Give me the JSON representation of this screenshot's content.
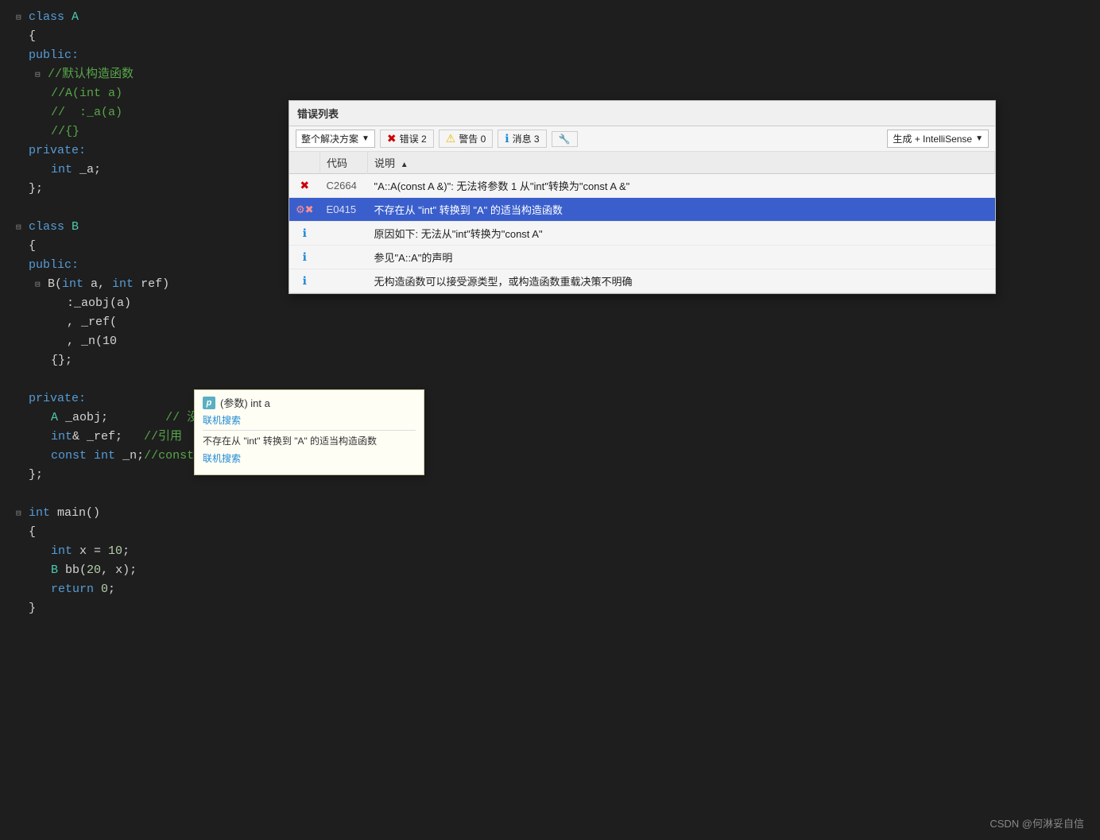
{
  "editor": {
    "lines": [
      {
        "indent": 0,
        "content": "class A",
        "type": "class-decl",
        "collapse": "⊟"
      },
      {
        "indent": 0,
        "content": "{",
        "type": "brace"
      },
      {
        "indent": 0,
        "content": "public:",
        "type": "access"
      },
      {
        "indent": 1,
        "content": "//默认构造函数",
        "type": "comment",
        "collapse": "⊟"
      },
      {
        "indent": 1,
        "content": "//A(int a)",
        "type": "comment"
      },
      {
        "indent": 1,
        "content": "//  :_a(a)",
        "type": "comment"
      },
      {
        "indent": 1,
        "content": "//{}",
        "type": "comment"
      },
      {
        "indent": 0,
        "content": "private:",
        "type": "access"
      },
      {
        "indent": 2,
        "content": "int _a;",
        "type": "decl"
      },
      {
        "indent": 0,
        "content": "};",
        "type": "brace"
      },
      {
        "indent": 0,
        "content": "",
        "type": "empty"
      },
      {
        "indent": 0,
        "content": "class B",
        "type": "class-decl",
        "collapse": "⊟"
      },
      {
        "indent": 0,
        "content": "{",
        "type": "brace"
      },
      {
        "indent": 0,
        "content": "public:",
        "type": "access"
      },
      {
        "indent": 1,
        "content": "B(int a, int ref)",
        "type": "func-decl",
        "collapse": "⊟"
      },
      {
        "indent": 2,
        "content": ":_aobj(a)",
        "type": "init"
      },
      {
        "indent": 2,
        "content": ", _ref(",
        "type": "init"
      },
      {
        "indent": 2,
        "content": ", _n(10",
        "type": "init"
      },
      {
        "indent": 1,
        "content": "{};",
        "type": "brace"
      },
      {
        "indent": 0,
        "content": "",
        "type": "empty"
      },
      {
        "indent": 0,
        "content": "private:",
        "type": "access"
      },
      {
        "indent": 2,
        "content": "A _aobj;  // 没有默认构造函数",
        "type": "decl-comment"
      },
      {
        "indent": 2,
        "content": "int& _ref;   //引用",
        "type": "decl-comment"
      },
      {
        "indent": 2,
        "content": "const int _n;//const",
        "type": "decl-comment"
      },
      {
        "indent": 0,
        "content": "};",
        "type": "brace"
      },
      {
        "indent": 0,
        "content": "",
        "type": "empty"
      },
      {
        "indent": 0,
        "content": "int main()",
        "type": "func-decl",
        "collapse": "⊟"
      },
      {
        "indent": 0,
        "content": "{",
        "type": "brace"
      },
      {
        "indent": 2,
        "content": "int x = 10;",
        "type": "decl"
      },
      {
        "indent": 2,
        "content": "B bb(20, x);",
        "type": "stmt"
      },
      {
        "indent": 2,
        "content": "return 0;",
        "type": "stmt"
      },
      {
        "indent": 0,
        "content": "}",
        "type": "brace"
      }
    ]
  },
  "error_panel": {
    "title": "错误列表",
    "filter_label": "整个解决方案",
    "error_count": "错误 2",
    "warning_count": "警告 0",
    "message_count": "消息 3",
    "filter_icon_label": "🔧",
    "build_label": "生成 + IntelliSense",
    "columns": [
      "代码",
      "说明"
    ],
    "rows": [
      {
        "icon": "error",
        "code": "C2664",
        "desc": "\"A::A(const A &)\": 无法将参数 1 从\"int\"转换为\"const A &\"",
        "selected": false
      },
      {
        "icon": "intellisense-error",
        "code": "E0415",
        "desc": "不存在从 \"int\" 转换到 \"A\" 的适当构造函数",
        "selected": true
      },
      {
        "icon": "info",
        "code": "",
        "desc": "原因如下: 无法从\"int\"转换为\"const A\"",
        "selected": false
      },
      {
        "icon": "info",
        "code": "",
        "desc": "参见\"A::A\"的声明",
        "selected": false
      },
      {
        "icon": "info",
        "code": "",
        "desc": "无构造函数可以接受源类型，或构造函数重载决策不明确",
        "selected": false
      }
    ]
  },
  "tooltip": {
    "param_label": "(参数) int a",
    "link1": "联机搜索",
    "error_text": "不存在从 \"int\" 转换到 \"A\" 的适当构造函数",
    "link2": "联机搜索"
  },
  "watermark": "CSDN @何淋妥自信"
}
